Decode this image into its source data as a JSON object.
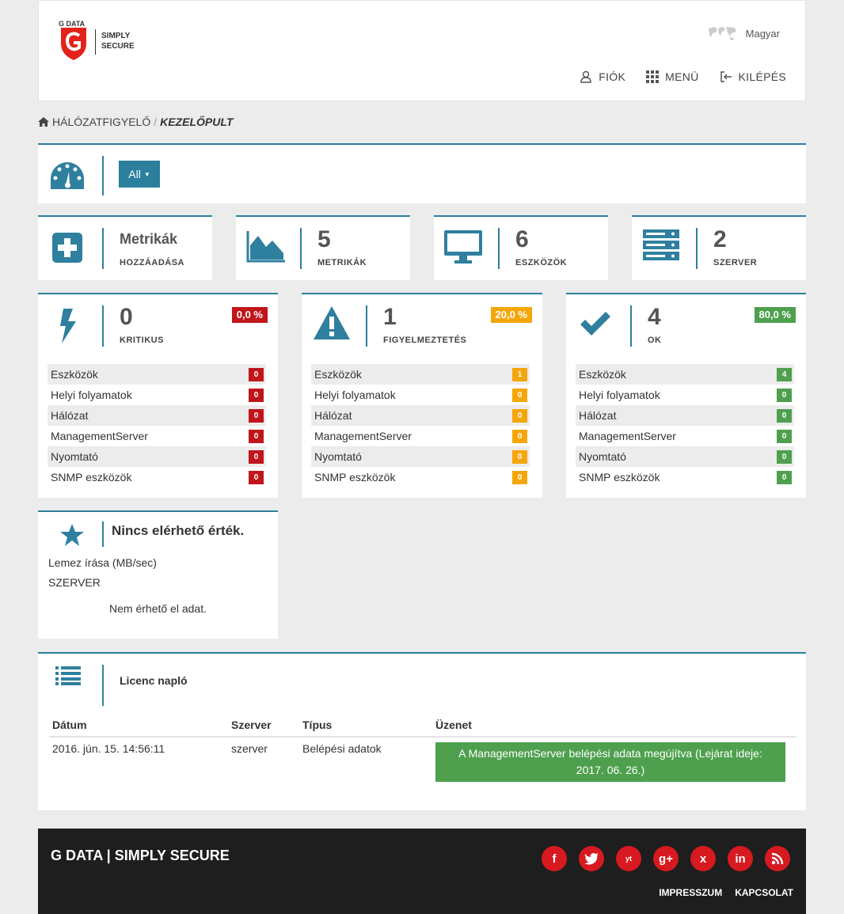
{
  "header": {
    "logo_brand": "G DATA",
    "logo_line1": "SIMPLY",
    "logo_line2": "SECURE",
    "language": "Magyar",
    "nav": {
      "account": "FIÓK",
      "menu": "MENÜ",
      "logout": "KILÉPÉS"
    }
  },
  "breadcrumb": {
    "parent": "HÁLÓZATFIGYELŐ",
    "separator": "/",
    "current": "KEZELŐPULT"
  },
  "filter": {
    "label": "All"
  },
  "summary": {
    "add_metrics": {
      "title": "Metrikák",
      "label": "HOZZÁADÁSA"
    },
    "metrics": {
      "value": "5",
      "label": "METRIKÁK"
    },
    "devices": {
      "value": "6",
      "label": "ESZKÖZÖK"
    },
    "servers": {
      "value": "2",
      "label": "SZERVER"
    }
  },
  "status": {
    "critical": {
      "value": "0",
      "label": "KRITIKUS",
      "percent": "0,0 %",
      "color": "#c0151b",
      "rows": [
        {
          "name": "Eszközök",
          "count": "0"
        },
        {
          "name": "Helyi folyamatok",
          "count": "0"
        },
        {
          "name": "Hálózat",
          "count": "0"
        },
        {
          "name": "ManagementServer",
          "count": "0"
        },
        {
          "name": "Nyomtató",
          "count": "0"
        },
        {
          "name": "SNMP eszközök",
          "count": "0"
        }
      ]
    },
    "warning": {
      "value": "1",
      "label": "FIGYELMEZTETÉS",
      "percent": "20,0 %",
      "color": "#f5a60b",
      "rows": [
        {
          "name": "Eszközök",
          "count": "1"
        },
        {
          "name": "Helyi folyamatok",
          "count": "0"
        },
        {
          "name": "Hálózat",
          "count": "0"
        },
        {
          "name": "ManagementServer",
          "count": "0"
        },
        {
          "name": "Nyomtató",
          "count": "0"
        },
        {
          "name": "SNMP eszközök",
          "count": "0"
        }
      ]
    },
    "ok": {
      "value": "4",
      "label": "OK",
      "percent": "80,0 %",
      "color": "#4ea04e",
      "rows": [
        {
          "name": "Eszközök",
          "count": "4"
        },
        {
          "name": "Helyi folyamatok",
          "count": "0"
        },
        {
          "name": "Hálózat",
          "count": "0"
        },
        {
          "name": "ManagementServer",
          "count": "0"
        },
        {
          "name": "Nyomtató",
          "count": "0"
        },
        {
          "name": "SNMP eszközök",
          "count": "0"
        }
      ]
    }
  },
  "favorite": {
    "title": "Nincs elérhető érték.",
    "metric": "Lemez írása (MB/sec)",
    "server": "SZERVER",
    "empty": "Nem érhető el adat."
  },
  "license_log": {
    "title": "Licenc napló",
    "columns": {
      "date": "Dátum",
      "server": "Szerver",
      "type": "Típus",
      "message": "Üzenet"
    },
    "row": {
      "date": "2016. jún. 15. 14:56:11",
      "server": "szerver",
      "type": "Belépési adatok",
      "message": "A ManagementServer belépési adata megújítva (Lejárat ideje: 2017. 06. 26.)"
    }
  },
  "footer": {
    "title": "G DATA | SIMPLY SECURE",
    "socials": [
      "f",
      "t",
      "yt",
      "g+",
      "x",
      "in",
      "rss"
    ],
    "links": {
      "impressum": "IMPRESSZUM",
      "contact": "KAPCSOLAT"
    }
  },
  "colors": {
    "accent": "#2c7f9c",
    "critical": "#c0151b",
    "warning": "#f5a60b",
    "ok": "#4ea04e",
    "brand_red": "#d71920"
  }
}
